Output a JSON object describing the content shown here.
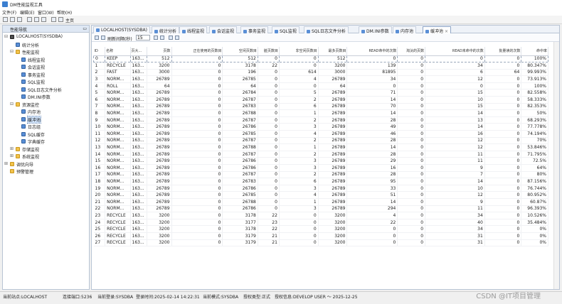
{
  "window": {
    "title": "DM性能监视工具"
  },
  "menu": [
    "文件(F)",
    "编辑(E)",
    "窗口(W)",
    "帮助(H)"
  ],
  "toolbar": {
    "home_label": "主页"
  },
  "navigator": {
    "title": "性能导航",
    "tree": [
      {
        "label": "LOCALHOST(SYSDBA)",
        "icon": "server",
        "exp": "⊟"
      },
      {
        "label": "统计分析",
        "icon": "item",
        "exp": ""
      },
      {
        "label": "性能监视",
        "icon": "folder",
        "exp": "⊟"
      },
      {
        "label": "线程监视",
        "icon": "item",
        "exp": ""
      },
      {
        "label": "会话监视",
        "icon": "item",
        "exp": ""
      },
      {
        "label": "事务监视",
        "icon": "item",
        "exp": ""
      },
      {
        "label": "SQL监视",
        "icon": "item",
        "exp": ""
      },
      {
        "label": "SQL日志文件分析",
        "icon": "item",
        "exp": ""
      },
      {
        "label": "DM.INI参数",
        "icon": "item",
        "exp": ""
      },
      {
        "label": "资源监控",
        "icon": "folder",
        "exp": "⊟"
      },
      {
        "label": "内存池",
        "icon": "item",
        "exp": ""
      },
      {
        "label": "缓冲池",
        "icon": "item",
        "exp": "",
        "selected": true
      },
      {
        "label": "日志组",
        "icon": "item",
        "exp": ""
      },
      {
        "label": "SQL缓存",
        "icon": "item",
        "exp": ""
      },
      {
        "label": "字典缓存",
        "icon": "item",
        "exp": ""
      },
      {
        "label": "存储监视",
        "icon": "folder",
        "exp": "⊞"
      },
      {
        "label": "系统监视",
        "icon": "folder",
        "exp": "⊞"
      },
      {
        "label": "调优向导",
        "icon": "folder",
        "exp": "⊞"
      },
      {
        "label": "预警管理",
        "icon": "folder",
        "exp": ""
      }
    ]
  },
  "tabs": [
    "LOCALHOST(SYSDBA)",
    "统计分析",
    "线程监视",
    "会话监视",
    "事务监视",
    "SQL监视",
    "SQL日志文件分析",
    "DM.INI参数",
    "内存池",
    "缓冲池"
  ],
  "active_tab": 9,
  "subtoolbar": {
    "refresh_label": "刷新间隔(秒)",
    "refresh_value": "15"
  },
  "table": {
    "columns": [
      "ID",
      "名称",
      "页大...",
      "页数",
      "正在使用的页数目",
      "空闲页数目",
      "脏页数目",
      "非空闲页数目",
      "最多页数目",
      "READ命中的次数",
      "淘汰的页数",
      "READ未命中的次数",
      "批量读的次数",
      "命中率"
    ],
    "rows": [
      [
        "0",
        "KEEP",
        "163...",
        "512",
        "0",
        "512",
        "0",
        "0",
        "512",
        "0",
        "0",
        "0",
        "0",
        "100%"
      ],
      [
        "1",
        "RECYCLE",
        "163...",
        "3200",
        "0",
        "3178",
        "22",
        "0",
        "3200",
        "139",
        "0",
        "34",
        "0",
        "80.347%"
      ],
      [
        "2",
        "FAST",
        "163...",
        "3000",
        "0",
        "196",
        "0",
        "614",
        "3000",
        "81895",
        "0",
        "6",
        "64",
        "99.993%"
      ],
      [
        "3",
        "NORM...",
        "163...",
        "26789",
        "0",
        "26785",
        "0",
        "4",
        "26789",
        "34",
        "0",
        "12",
        "0",
        "73.913%"
      ],
      [
        "4",
        "ROLL",
        "163...",
        "64",
        "0",
        "64",
        "0",
        "0",
        "64",
        "0",
        "0",
        "0",
        "0",
        "100%"
      ],
      [
        "5",
        "NORM...",
        "163...",
        "26789",
        "0",
        "26784",
        "0",
        "5",
        "26789",
        "71",
        "0",
        "15",
        "0",
        "82.558%"
      ],
      [
        "6",
        "NORM...",
        "163...",
        "26789",
        "0",
        "26787",
        "0",
        "2",
        "26789",
        "14",
        "0",
        "10",
        "0",
        "58.333%"
      ],
      [
        "7",
        "NORM...",
        "163...",
        "26789",
        "0",
        "26783",
        "0",
        "6",
        "26789",
        "70",
        "0",
        "15",
        "0",
        "82.353%"
      ],
      [
        "8",
        "NORM...",
        "163...",
        "26789",
        "0",
        "26788",
        "0",
        "1",
        "26789",
        "14",
        "0",
        "14",
        "0",
        "50%"
      ],
      [
        "9",
        "NORM...",
        "163...",
        "26789",
        "0",
        "26787",
        "0",
        "2",
        "26789",
        "28",
        "0",
        "13",
        "0",
        "68.293%"
      ],
      [
        "10",
        "NORM...",
        "163...",
        "26789",
        "0",
        "26786",
        "0",
        "3",
        "26789",
        "49",
        "0",
        "14",
        "0",
        "77.778%"
      ],
      [
        "11",
        "NORM...",
        "163...",
        "26789",
        "0",
        "26785",
        "0",
        "4",
        "26789",
        "46",
        "0",
        "16",
        "0",
        "74.194%"
      ],
      [
        "12",
        "NORM...",
        "163...",
        "26789",
        "0",
        "26787",
        "0",
        "2",
        "26789",
        "28",
        "0",
        "12",
        "0",
        "70%"
      ],
      [
        "13",
        "NORM...",
        "163...",
        "26789",
        "0",
        "26788",
        "0",
        "1",
        "26789",
        "14",
        "0",
        "12",
        "0",
        "53.846%"
      ],
      [
        "14",
        "NORM...",
        "163...",
        "26789",
        "0",
        "26787",
        "0",
        "2",
        "26789",
        "28",
        "0",
        "11",
        "0",
        "71.795%"
      ],
      [
        "15",
        "NORM...",
        "163...",
        "26789",
        "0",
        "26786",
        "0",
        "3",
        "26789",
        "29",
        "0",
        "11",
        "0",
        "72.5%"
      ],
      [
        "16",
        "NORM...",
        "163...",
        "26789",
        "0",
        "26786",
        "0",
        "3",
        "26789",
        "16",
        "0",
        "9",
        "0",
        "64%"
      ],
      [
        "17",
        "NORM...",
        "163...",
        "26789",
        "0",
        "26787",
        "0",
        "2",
        "26789",
        "28",
        "0",
        "7",
        "0",
        "80%"
      ],
      [
        "18",
        "NORM...",
        "163...",
        "26789",
        "0",
        "26783",
        "0",
        "6",
        "26789",
        "95",
        "0",
        "14",
        "0",
        "87.156%"
      ],
      [
        "19",
        "NORM...",
        "163...",
        "26789",
        "0",
        "26786",
        "0",
        "3",
        "26789",
        "33",
        "0",
        "10",
        "0",
        "76.744%"
      ],
      [
        "20",
        "NORM...",
        "163...",
        "26789",
        "0",
        "26785",
        "0",
        "4",
        "26789",
        "51",
        "0",
        "12",
        "0",
        "80.952%"
      ],
      [
        "21",
        "NORM...",
        "163...",
        "26789",
        "0",
        "26788",
        "0",
        "1",
        "26789",
        "14",
        "0",
        "9",
        "0",
        "60.87%"
      ],
      [
        "22",
        "NORM...",
        "163...",
        "26789",
        "0",
        "26786",
        "0",
        "3",
        "26789",
        "294",
        "0",
        "11",
        "0",
        "96.393%"
      ],
      [
        "23",
        "RECYCLE",
        "163...",
        "3200",
        "0",
        "3178",
        "22",
        "0",
        "3200",
        "4",
        "0",
        "34",
        "0",
        "10.526%"
      ],
      [
        "24",
        "RECYCLE",
        "163...",
        "3200",
        "0",
        "3177",
        "23",
        "0",
        "3200",
        "22",
        "0",
        "40",
        "0",
        "35.484%"
      ],
      [
        "25",
        "RECYCLE",
        "163...",
        "3200",
        "0",
        "3178",
        "22",
        "0",
        "3200",
        "0",
        "0",
        "34",
        "0",
        "0%"
      ],
      [
        "26",
        "RECYCLE",
        "163...",
        "3200",
        "0",
        "3179",
        "21",
        "0",
        "3200",
        "0",
        "0",
        "31",
        "0",
        "0%"
      ],
      [
        "27",
        "RECYCLE",
        "163...",
        "3200",
        "0",
        "3179",
        "21",
        "0",
        "3200",
        "0",
        "0",
        "31",
        "0",
        "0%"
      ]
    ]
  },
  "status": {
    "site": "当前站点:LOCALHOST",
    "port": "连接端口:5236",
    "login": "当前登录:SYSDBA",
    "login_time": "登录时间:2025-02-14 14:22:31",
    "mode": "当前模式:SYSDBA",
    "license_type": "授权类型:正式",
    "license_user": "授权信息:DEVELOP USER ～ 2025-12-25"
  },
  "watermark": "CSDN @IT项目管理"
}
